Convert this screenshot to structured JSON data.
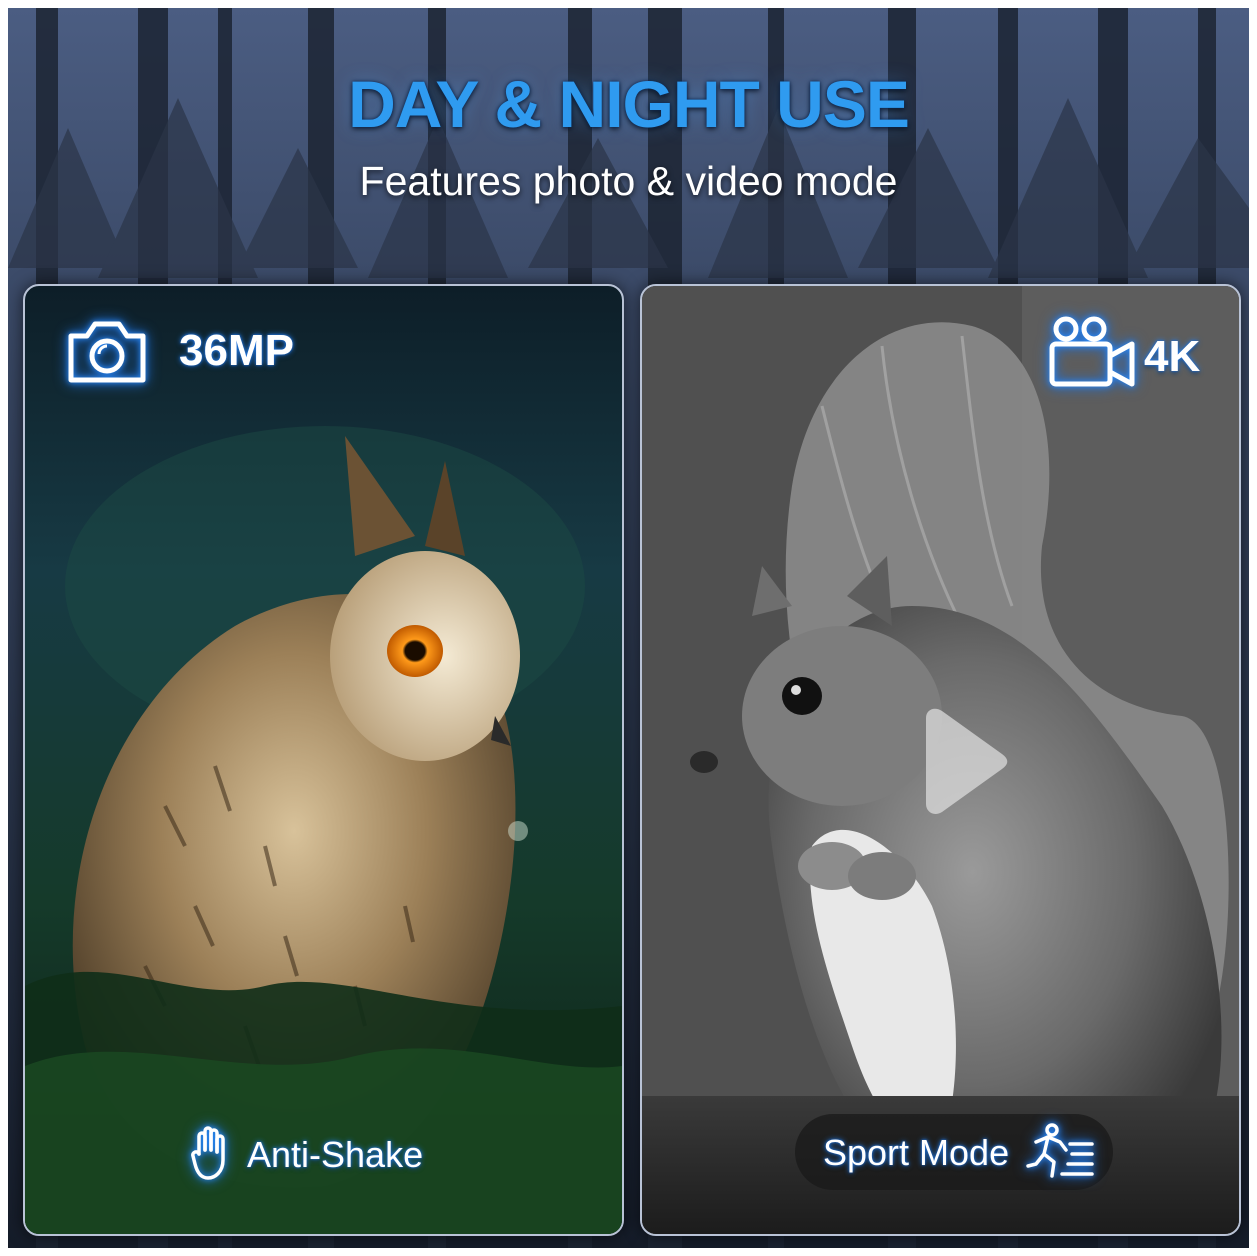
{
  "header": {
    "title": "DAY & NIGHT USE",
    "subtitle": "Features photo & video mode"
  },
  "photo_panel": {
    "resolution": "36MP",
    "icon": "camera-icon",
    "feature": "Anti-Shake",
    "feature_icon": "hand-icon"
  },
  "video_panel": {
    "resolution": "4K",
    "icon": "video-camera-icon",
    "feature": "Sport Mode",
    "feature_icon": "running-person-icon",
    "overlay_icon": "play-icon"
  },
  "colors": {
    "accent": "#2f9bf0",
    "glow": "#2a8cff",
    "background": "#2e3a52"
  }
}
